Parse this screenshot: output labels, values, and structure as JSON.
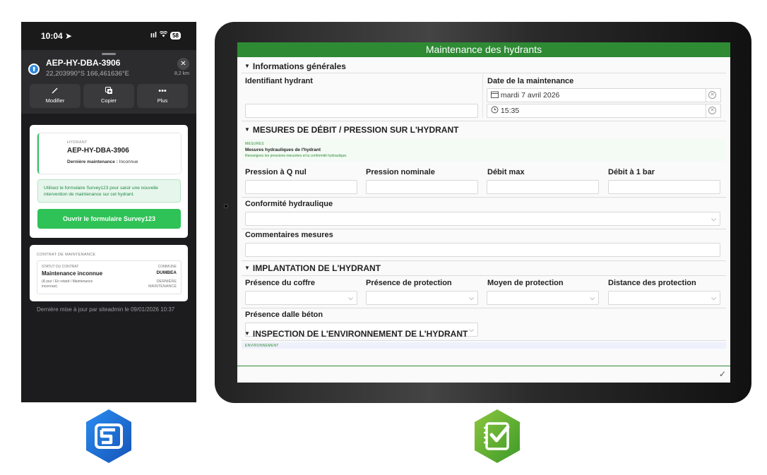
{
  "phone": {
    "status_time": "10:04",
    "status_signal": "ııl",
    "status_battery": "58",
    "feature_title": "AEP-HY-DBA-3906",
    "feature_coords": "22,203990°S 166,461636°E",
    "distance": "8,2 km",
    "actions": [
      {
        "label": "Modifier",
        "icon": "pencil-icon"
      },
      {
        "label": "Copier",
        "icon": "copy-icon"
      },
      {
        "label": "Plus",
        "icon": "more-icon"
      }
    ],
    "hydrant_kicker": "HYDRANT",
    "hydrant_name": "AEP-HY-DBA-3906",
    "last_maintenance_label": "Dernière maintenance :",
    "last_maintenance_value": "Inconnue",
    "info_text": "Utilisez le formulaire Survey123 pour saisir une nouvelle intervention de maintenance sur cet hydrant.",
    "open_button": "Ouvrir le formulaire Survey123",
    "contract": {
      "title": "CONTRAT DE MAINTENANCE",
      "status_label": "STATUT DU CONTRAT",
      "status_value": "Maintenance inconnue",
      "status_note": "(À jour / En retard / Maintenance inconnue)",
      "commune_label": "COMMUNE",
      "commune_value": "DUMBEA",
      "last_label": "DERNIÈRE MAINTENANCE"
    },
    "update_note": "Dernière mise à jour par siteadmin le 09/01/2026 10:37"
  },
  "form": {
    "title": "Maintenance des hydrants",
    "sections": {
      "general": "Informations générales",
      "mesures": "MESURES DE DÉBIT / PRESSION SUR L'HYDRANT",
      "implantation": "IMPLANTATION DE L'HYDRANT",
      "inspection": "INSPECTION DE L'ENVIRONNEMENT DE L'HYDRANT"
    },
    "identifiant_label": "Identifiant hydrant",
    "date_label": "Date de la maintenance",
    "date_value": "mardi 7 avril 2026",
    "time_value": "15:35",
    "mesures_kicker": "MESURES",
    "mesures_subtitle": "Mesures hydrauliques de l'hydrant",
    "mesures_help": "Renseignez les pressions mesurées et la conformité hydraulique.",
    "pression_q_nul": "Pression à Q nul",
    "pression_nominale": "Pression nominale",
    "debit_max": "Débit max",
    "debit_1bar": "Débit à 1 bar",
    "conformite": "Conformité hydraulique",
    "commentaires": "Commentaires mesures",
    "presence_coffre": "Présence du coffre",
    "presence_protection": "Présence de protection",
    "moyen_protection": "Moyen de protection",
    "distance_protection": "Distance des protection",
    "dalle_beton": "Présence dalle béton",
    "env_kicker": "ENVIRONNEMENT"
  },
  "colors": {
    "survey_green": "#2e8b34",
    "button_green": "#2ec257",
    "field_maps_blue": "#1f6fd1",
    "survey123_green": "#5cae2f"
  },
  "icons": {
    "field_maps": "field-maps-app-icon",
    "survey123": "survey123-app-icon"
  }
}
